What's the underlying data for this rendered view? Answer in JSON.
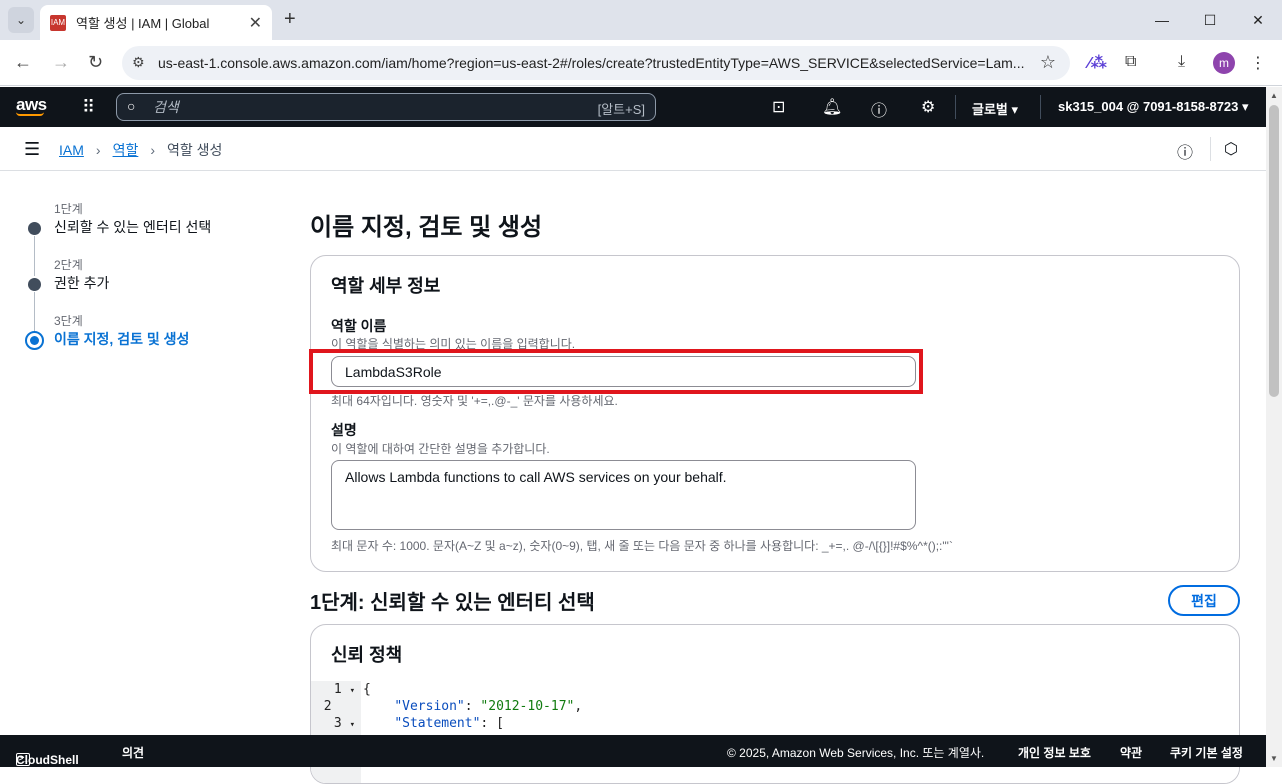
{
  "browser": {
    "tab_title": "역할 생성 | IAM | Global",
    "url": "us-east-1.console.aws.amazon.com/iam/home?region=us-east-2#/roles/create?trustedEntityType=AWS_SERVICE&selectedService=Lam...",
    "profile_initial": "m"
  },
  "aws_header": {
    "logo": "aws",
    "search_placeholder": "검색",
    "search_shortcut": "[알트+S]",
    "region": "글로벌 ▾",
    "account": "sk315_004 @ 7091-8158-8723 ▾"
  },
  "breadcrumb": {
    "items": [
      "IAM",
      "역할"
    ],
    "current": "역할 생성"
  },
  "steps": [
    {
      "number": "1단계",
      "label": "신뢰할 수 있는 엔터티 선택"
    },
    {
      "number": "2단계",
      "label": "권한 추가"
    },
    {
      "number": "3단계",
      "label": "이름 지정, 검토 및 생성"
    }
  ],
  "main": {
    "title": "이름 지정, 검토 및 생성",
    "role_details": {
      "heading": "역할 세부 정보",
      "role_name_label": "역할 이름",
      "role_name_desc": "이 역할을 식별하는 의미 있는 이름을 입력합니다.",
      "role_name_value": "LambdaS3Role",
      "role_name_constraint": "최대 64자입니다. 영숫자 및 '+=,.@-_' 문자를 사용하세요.",
      "description_label": "설명",
      "description_desc": "이 역할에 대하여 간단한 설명을 추가합니다.",
      "description_value": "Allows Lambda functions to call AWS services on your behalf.",
      "description_constraint": "최대 문자 수: 1000. 문자(A~Z 및 a~z), 숫자(0~9), 탭, 새 줄 또는 다음 문자 중 하나를 사용합니다: _+=,. @-/\\[{}]!#$%^*();:\"'`"
    },
    "step1_section_title": "1단계: 신뢰할 수 있는 엔터티 선택",
    "edit_button": "편집",
    "trust_policy": {
      "heading": "신뢰 정책",
      "lines": [
        {
          "num": "1",
          "fold": "▾",
          "text": "{"
        },
        {
          "num": "2",
          "fold": "",
          "key": "\"Version\"",
          "sep": ": ",
          "val": "\"2012-10-17\"",
          "end": ","
        },
        {
          "num": "3",
          "fold": "▾",
          "key": "\"Statement\"",
          "sep": ": ",
          "val": "",
          "end": "["
        }
      ]
    }
  },
  "footer": {
    "cloudshell": "CloudShell",
    "feedback": "의견",
    "copyright": "© 2025, Amazon Web Services, Inc. 또는 계열사.",
    "privacy": "개인 정보 보호",
    "terms": "약관",
    "cookies": "쿠키 기본 설정"
  }
}
